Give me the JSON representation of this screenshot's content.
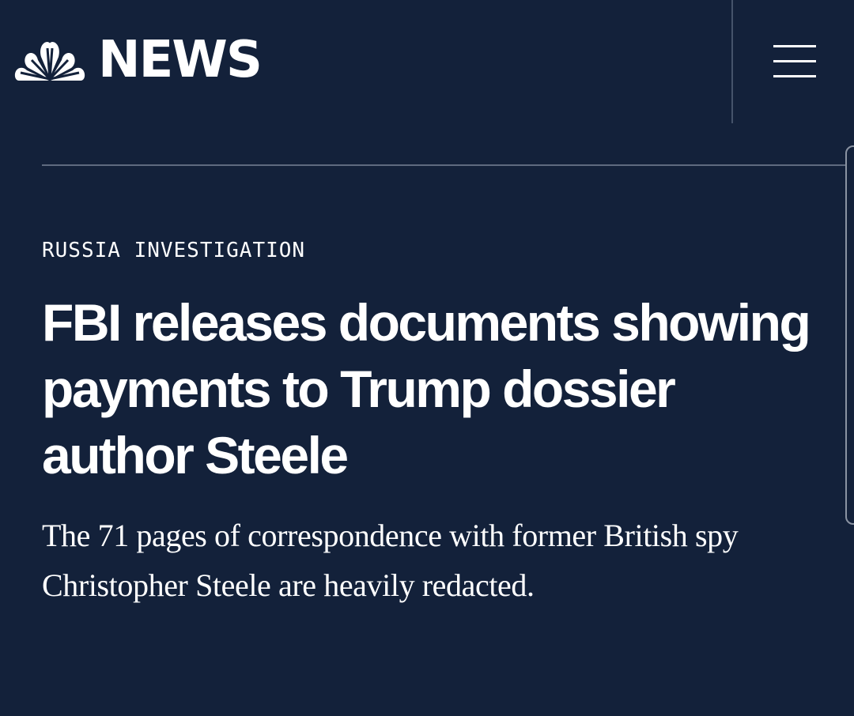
{
  "header": {
    "logo_text": "NEWS",
    "logo_icon": "nbc-peacock-icon",
    "menu_icon": "hamburger-menu-icon"
  },
  "article": {
    "category": "RUSSIA INVESTIGATION",
    "headline": "FBI releases documents showing payments to Trump dossier author Steele",
    "dek": "The 71 pages of correspondence with former British spy Christopher Steele are heavily redacted."
  },
  "colors": {
    "background": "#13213a",
    "text": "#ffffff",
    "divider": "#5f6b7f"
  }
}
